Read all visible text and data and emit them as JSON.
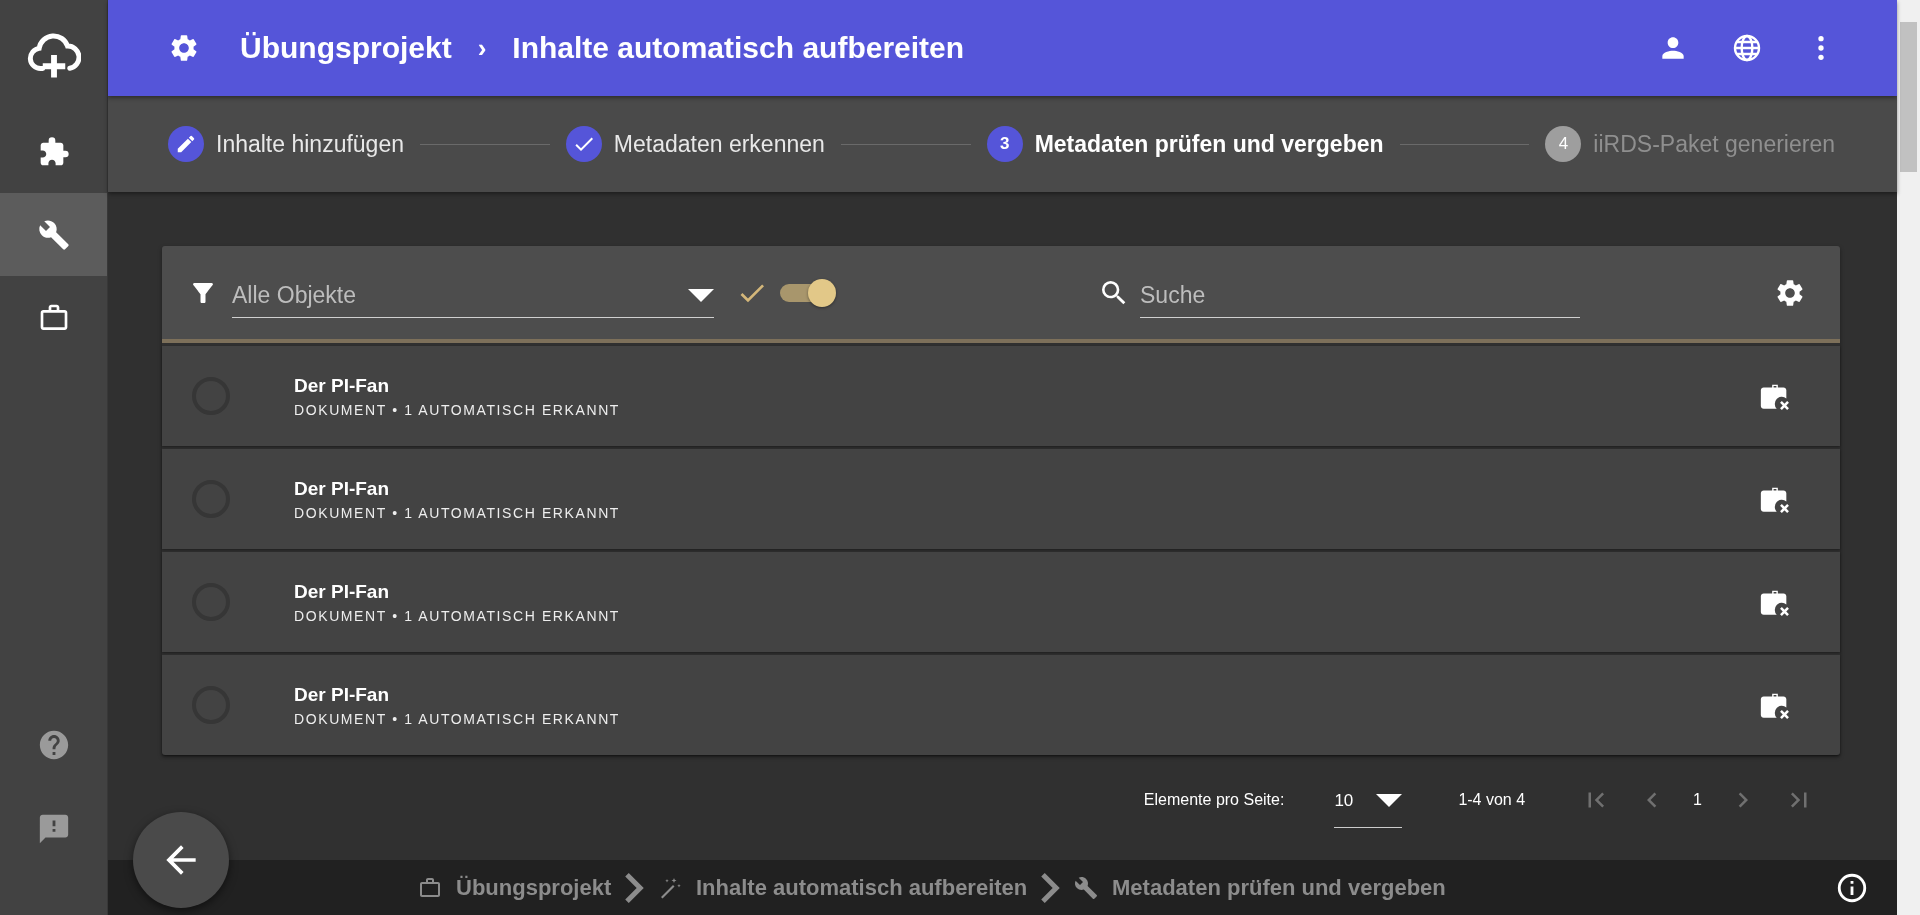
{
  "sidebar": {
    "items": [
      {
        "kind": "extension",
        "selected": false
      },
      {
        "kind": "build",
        "selected": true
      },
      {
        "kind": "work",
        "selected": false
      }
    ],
    "bottom_items": [
      {
        "kind": "help"
      },
      {
        "kind": "feedback"
      }
    ]
  },
  "header": {
    "project": "Übungsprojekt",
    "separator": "›",
    "title": "Inhalte automatisch aufbereiten"
  },
  "steps": [
    {
      "kind": "edit",
      "label": "Inhalte hinzufügen",
      "selected": false
    },
    {
      "kind": "done",
      "label": "Metadaten erkennen",
      "selected": false
    },
    {
      "kind": "number",
      "number": "3",
      "label": "Metadaten prüfen und vergeben",
      "selected": true
    },
    {
      "kind": "number",
      "number": "4",
      "label": "iiRDS-Paket generieren",
      "selected": false
    }
  ],
  "toolbar": {
    "filter_value": "Alle Objekte",
    "toggle_on": true,
    "search_placeholder": "Suche"
  },
  "rows": [
    {
      "title": "Der PI-Fan",
      "subtitle": "DOKUMENT • 1 AUTOMATISCH ERKANNT",
      "selected": false
    },
    {
      "title": "Der PI-Fan",
      "subtitle": "DOKUMENT • 1 AUTOMATISCH ERKANNT",
      "selected": false
    },
    {
      "title": "Der PI-Fan",
      "subtitle": "DOKUMENT • 1 AUTOMATISCH ERKANNT",
      "selected": false
    },
    {
      "title": "Der PI-Fan",
      "subtitle": "DOKUMENT • 1 AUTOMATISCH ERKANNT",
      "selected": false
    }
  ],
  "paginator": {
    "label": "Elemente pro Seite:",
    "page_size": "10",
    "range": "1-4 von 4",
    "page": "1",
    "nav": [
      {
        "kind": "first",
        "disabled": true
      },
      {
        "kind": "prev",
        "disabled": true
      },
      {
        "kind": "next",
        "disabled": true
      },
      {
        "kind": "last",
        "disabled": true
      }
    ]
  },
  "footer": {
    "breadcrumb": [
      {
        "kind": "work",
        "label": "Übungsprojekt"
      },
      {
        "kind": "wand",
        "label": "Inhalte automatisch aufbereiten"
      },
      {
        "kind": "build",
        "label": "Metadaten prüfen und vergeben"
      }
    ]
  }
}
